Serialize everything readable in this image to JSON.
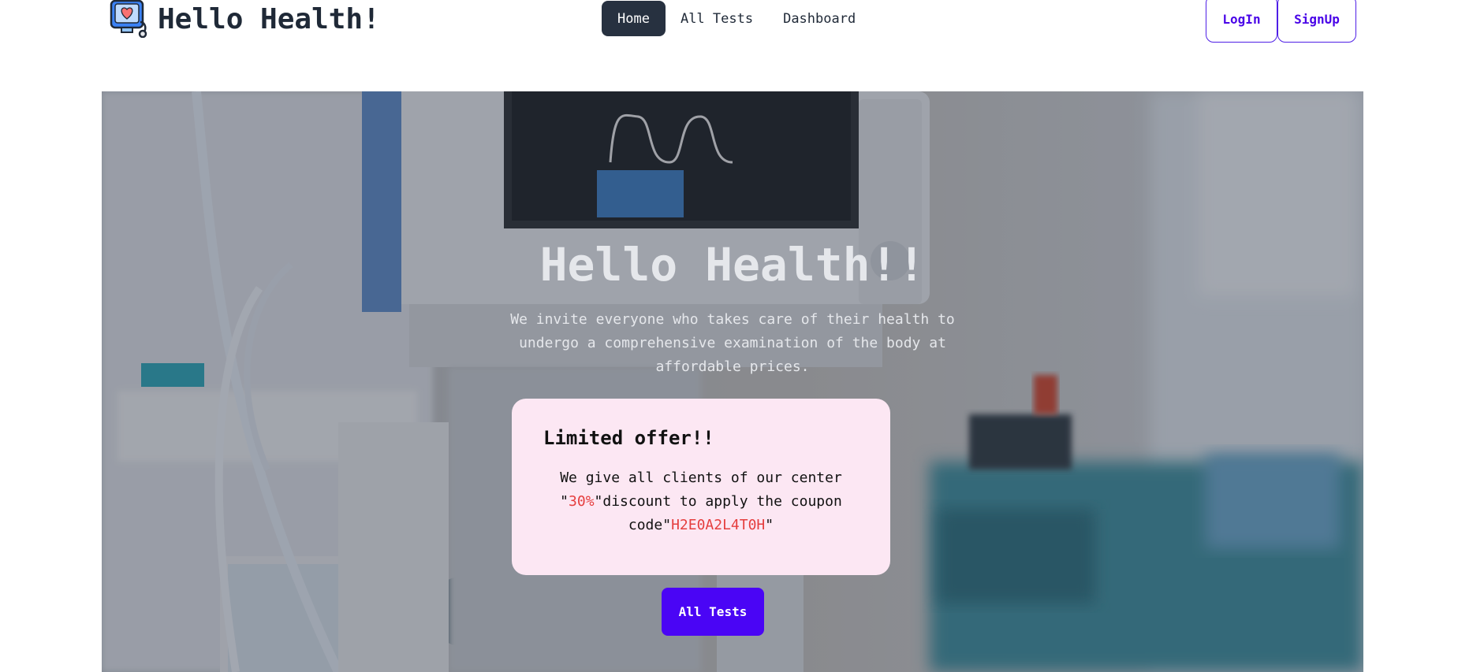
{
  "brand": {
    "title": "Hello Health!",
    "logo_icon": "monitor-heart-stethoscope-icon"
  },
  "nav": {
    "items": [
      {
        "label": "Home",
        "active": true
      },
      {
        "label": "All Tests",
        "active": false
      },
      {
        "label": "Dashboard",
        "active": false
      }
    ]
  },
  "auth": {
    "login_label": "LogIn",
    "signup_label": "SignUp"
  },
  "hero": {
    "title": "Hello Health!!",
    "subtitle": "We invite everyone who takes care of their health to undergo a comprehensive examination of the body at affordable prices.",
    "background": "hospital-monitor-photo"
  },
  "offer": {
    "title": "Limited offer!!",
    "text_before": "We give all clients of our center \"",
    "discount": "30%",
    "text_middle": "\"discount to apply the coupon code\"",
    "coupon": "H2E0A2L4T0H",
    "text_after": "\""
  },
  "cta": {
    "label": "All Tests"
  },
  "colors": {
    "accent": "#4a05f5",
    "nav_active": "#273140",
    "offer_bg": "#fce7f3",
    "highlight": "#e53e3e"
  }
}
